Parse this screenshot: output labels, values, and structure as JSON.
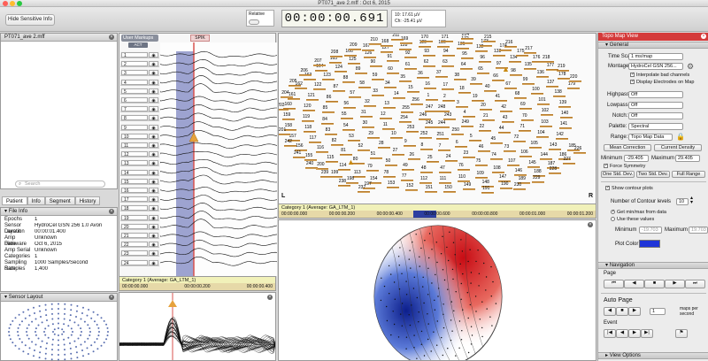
{
  "window": {
    "title": "PT071_ave 2.mff : Oct 6, 2015"
  },
  "toolbar": {
    "hide_label": "Hide Sensitive Info",
    "relative_label": "Relative",
    "clock": "00:00:00.691",
    "readout_line1": "10: 17.61 µV",
    "readout_line2": "Ch: -25.41 µV"
  },
  "files": {
    "item": "PT071_ave 2.mff",
    "search_placeholder": "Search"
  },
  "tabs": [
    "Patient",
    "Info",
    "Segment",
    "History"
  ],
  "file_info": {
    "header": "File Info",
    "rows": [
      {
        "k": "Epochs",
        "v": "1"
      },
      {
        "k": "Sensor Layout",
        "v": "HydroCel GSN 256 1.0 Avon"
      },
      {
        "k": "Duration",
        "v": "00:00:01.400"
      },
      {
        "k": "Amp Firmware",
        "v": "Unknown"
      },
      {
        "k": "Date",
        "v": "Oct 6, 2015"
      },
      {
        "k": "Amp Serial",
        "v": "Unknown"
      },
      {
        "k": "Categories",
        "v": "1"
      },
      {
        "k": "Sampling Rate",
        "v": "1000 Samples/Second"
      },
      {
        "k": "Samples",
        "v": "1,400"
      }
    ]
  },
  "sensor_layout": {
    "header": "Sensor Layout"
  },
  "channels": {
    "markup_label": "User Markups",
    "act_label": "ACT",
    "spike_label": "SPIK",
    "rows": [
      "1",
      "2",
      "3",
      "4",
      "5",
      "6",
      "7",
      "8",
      "9",
      "10",
      "11",
      "12",
      "13",
      "14",
      "15",
      "16",
      "17",
      "18",
      "19",
      "20",
      "21",
      "22",
      "23",
      "24"
    ],
    "status": "Category 1 (Average: GA_LTM_1)",
    "time_ticks": [
      "00:00:00.000",
      "00:00:00.200",
      "00:00:00.400"
    ]
  },
  "topomap": {
    "status": "Category 1 (Average: GA_LTM_1)",
    "time_ticks": [
      "00:00:00.000",
      "00:00:00.200",
      "00:00:00.400",
      "00:00:00.600",
      "00:00:00.800",
      "00:00:01.000",
      "00:00:01.200"
    ],
    "left_marker": "L",
    "right_marker": "R",
    "electrodes": [
      "243",
      "244",
      "245",
      "246",
      "247",
      "248",
      "249",
      "250",
      "251",
      "252",
      "253",
      "254",
      "255",
      "256",
      "1",
      "2",
      "3",
      "4",
      "5",
      "6",
      "7",
      "8",
      "9",
      "10",
      "11",
      "12",
      "13",
      "14",
      "15",
      "16",
      "17",
      "18",
      "19",
      "20",
      "21",
      "22",
      "23",
      "24",
      "25",
      "26",
      "27",
      "28",
      "29",
      "30",
      "31",
      "32",
      "33",
      "34",
      "35",
      "36",
      "37",
      "38",
      "39",
      "40",
      "41",
      "42",
      "43",
      "44",
      "45",
      "46",
      "47",
      "48",
      "49",
      "50",
      "51",
      "52",
      "53",
      "54",
      "55",
      "56",
      "57",
      "58",
      "59",
      "60",
      "61",
      "62",
      "63",
      "64",
      "65",
      "66",
      "67",
      "68",
      "69",
      "70",
      "71",
      "72",
      "73",
      "74",
      "75",
      "76",
      "77",
      "78",
      "79",
      "80",
      "81",
      "82",
      "83",
      "84",
      "85",
      "86",
      "87",
      "88",
      "89",
      "90",
      "91",
      "92",
      "93",
      "94",
      "95",
      "96",
      "97",
      "98",
      "99",
      "100",
      "101",
      "102",
      "103",
      "104",
      "105",
      "106",
      "107",
      "108",
      "109",
      "110",
      "111",
      "112",
      "113",
      "114",
      "115",
      "116",
      "117",
      "118",
      "119",
      "120",
      "121",
      "122",
      "123",
      "124",
      "125",
      "126",
      "127",
      "128",
      "129",
      "130",
      "131",
      "132",
      "133",
      "134",
      "135",
      "136",
      "137",
      "138",
      "139",
      "140",
      "141",
      "142",
      "143",
      "144",
      "145",
      "146",
      "147",
      "148",
      "149",
      "150",
      "151",
      "152",
      "153",
      "154",
      "155",
      "156",
      "157",
      "158",
      "159",
      "160",
      "161",
      "162",
      "163",
      "164",
      "165",
      "166",
      "167",
      "168",
      "169",
      "170",
      "171",
      "172",
      "173",
      "174",
      "175",
      "176",
      "177",
      "178",
      "179",
      "180",
      "181",
      "182",
      "183",
      "184",
      "185",
      "186",
      "187",
      "188",
      "189",
      "190",
      "191",
      "192",
      "193",
      "194",
      "195",
      "196",
      "197",
      "198",
      "199",
      "200",
      "201",
      "202",
      "203",
      "204",
      "205",
      "206",
      "207",
      "208",
      "209",
      "210",
      "211",
      "212",
      "213",
      "214",
      "215",
      "216",
      "217",
      "218",
      "219",
      "220",
      "221",
      "222",
      "223",
      "224",
      "225",
      "226",
      "227",
      "228",
      "229",
      "230",
      "231",
      "232",
      "233",
      "234",
      "235",
      "236",
      "237",
      "238",
      "239",
      "240",
      "241",
      "242"
    ]
  },
  "topo_view": {
    "header": "Topo Map View",
    "general": "General",
    "time_scale_label": "Time Scale:",
    "time_scale_value": "1 ms/map",
    "montage_label": "Montage:",
    "montage_value": "HydroCel GSN 256...",
    "interpolate": "Interpolate bad channels",
    "display_electrodes": "Display Electrodes on Map",
    "highpass_label": "Highpass:",
    "highpass_value": "Off",
    "lowpass_label": "Lowpass:",
    "lowpass_value": "Off",
    "notch_label": "Notch:",
    "notch_value": "Off",
    "palette_label": "Palette:",
    "palette_value": "Spectral",
    "range_label": "Range:",
    "range_value": "Topo Map Data",
    "mean_correction": "Mean Correction",
    "current_density": "Current Density",
    "minimum_label": "Minimum",
    "minimum_value": "-29.405",
    "maximum_label": "Maximum",
    "maximum_value": "29.405",
    "force_symmetry": "Force Symmetry",
    "one_std": "One Std. Dev.",
    "two_std": "Two Std. Dev.",
    "full_range": "Full Range",
    "show_contour": "Show contour plots",
    "contour_levels_label": "Number of Contour levels",
    "contour_levels_value": "10",
    "get_minmax": "Get min/max from data",
    "use_values": "Use these values",
    "contour_min_label": "Minimum",
    "contour_min_value": "-19.703",
    "contour_max_label": "Maximum",
    "contour_max_value": "19.703",
    "plot_color_label": "Plot Color",
    "plot_color": "#1f35d8",
    "navigation": "Navigation",
    "page_label": "Page",
    "auto_page": "Auto Page",
    "auto_page_value": "1",
    "maps_per_second": "maps per second",
    "event_label": "Event",
    "view_options": "View Options"
  }
}
